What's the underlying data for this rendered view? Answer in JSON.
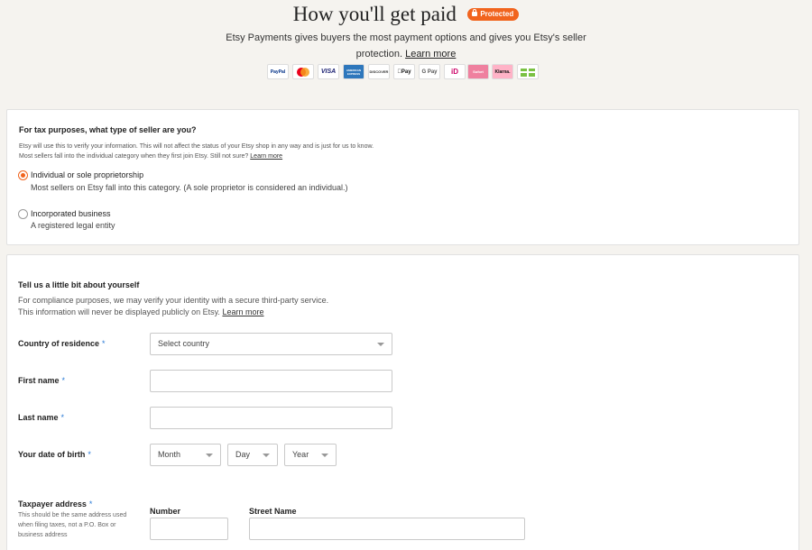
{
  "header": {
    "title": "How you'll get paid",
    "badge": "Protected",
    "subtitle": "Etsy Payments gives buyers the most payment options and gives you Etsy's seller protection.",
    "learn_more": "Learn more"
  },
  "payment_methods": [
    {
      "name": "PayPal",
      "icon": "paypal-icon"
    },
    {
      "name": "Mastercard",
      "icon": "mastercard-icon"
    },
    {
      "name": "VISA",
      "icon": "visa-icon"
    },
    {
      "name": "AMERICAN EXPRESS",
      "icon": "amex-icon"
    },
    {
      "name": "DISCOVER",
      "icon": "discover-icon"
    },
    {
      "name": "Pay",
      "icon": "apple-pay-icon"
    },
    {
      "name": "G Pay",
      "icon": "google-pay-icon"
    },
    {
      "name": "iD",
      "icon": "ideal-icon"
    },
    {
      "name": "Sofort",
      "icon": "sofort-icon"
    },
    {
      "name": "Klarna.",
      "icon": "klarna-icon"
    },
    {
      "name": "",
      "icon": "gift-card-icon"
    }
  ],
  "seller_type": {
    "heading": "For tax purposes, what type of seller are you?",
    "info_line1": "Etsy will use this to verify your information. This will not affect the status of your Etsy shop in any way and is just for us to know.",
    "info_line2": "Most sellers fall into the individual category when they first join Etsy. Still not sure?",
    "info_link": "Learn more",
    "options": [
      {
        "label": "Individual or sole proprietorship",
        "description": "Most sellers on Etsy fall into this category. (A sole proprietor is considered an individual.)",
        "selected": true
      },
      {
        "label": "Incorporated business",
        "description": "A registered legal entity",
        "selected": false
      }
    ]
  },
  "about": {
    "heading": "Tell us a little bit about yourself",
    "note_line1": "For compliance purposes, we may verify your identity with a secure third-party service.",
    "note_line2": "This information will never be displayed publicly on Etsy.",
    "note_link": "Learn more",
    "required_mark": "*",
    "country_label": "Country of residence",
    "country_value": "Select country",
    "first_name_label": "First name",
    "last_name_label": "Last name",
    "dob_label": "Your date of birth",
    "dob_month": "Month",
    "dob_day": "Day",
    "dob_year": "Year",
    "address_label": "Taxpayer address",
    "address_hint": "This should be the same address used when filing taxes, not a P.O. Box or business address",
    "number_label": "Number",
    "street_label": "Street Name"
  },
  "colors": {
    "accent": "#f1641e",
    "required": "#2c7bd6",
    "background": "#f5f3ef"
  }
}
